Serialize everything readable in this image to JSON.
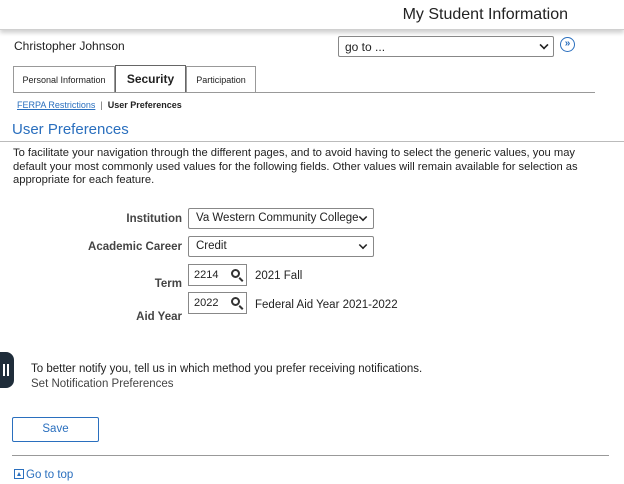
{
  "header": {
    "title": "My Student Information"
  },
  "user": {
    "name": "Christopher Johnson"
  },
  "goto": {
    "value": "go to ..."
  },
  "tabs": [
    {
      "label": "Personal Information"
    },
    {
      "label": "Security"
    },
    {
      "label": "Participation"
    }
  ],
  "subnav": {
    "link": "FERPA Restrictions",
    "separator": "|",
    "current": "User Preferences"
  },
  "page": {
    "title": "User Preferences",
    "intro": "To facilitate your navigation through the different pages, and to avoid having to select the generic values, you may default your most commonly used values for the following fields. Other values will remain available for selection as appropriate for each feature."
  },
  "form": {
    "institution": {
      "label": "Institution",
      "value": "Va Western Community College"
    },
    "career": {
      "label": "Academic Career",
      "value": "Credit"
    },
    "term": {
      "label": "Term",
      "value": "2214",
      "description": "2021 Fall"
    },
    "aid_year": {
      "label": "Aid Year",
      "value": "2022",
      "description": "Federal Aid Year 2021-2022"
    }
  },
  "notify": {
    "text": "To better notify you, tell us in which method you prefer receiving notifications.",
    "link": "Set Notification Preferences"
  },
  "actions": {
    "save_label": "Save",
    "top_link": "Go to top"
  },
  "colors": {
    "accent": "#2a6fbe",
    "sidebar_tab": "#1f2d3a"
  }
}
